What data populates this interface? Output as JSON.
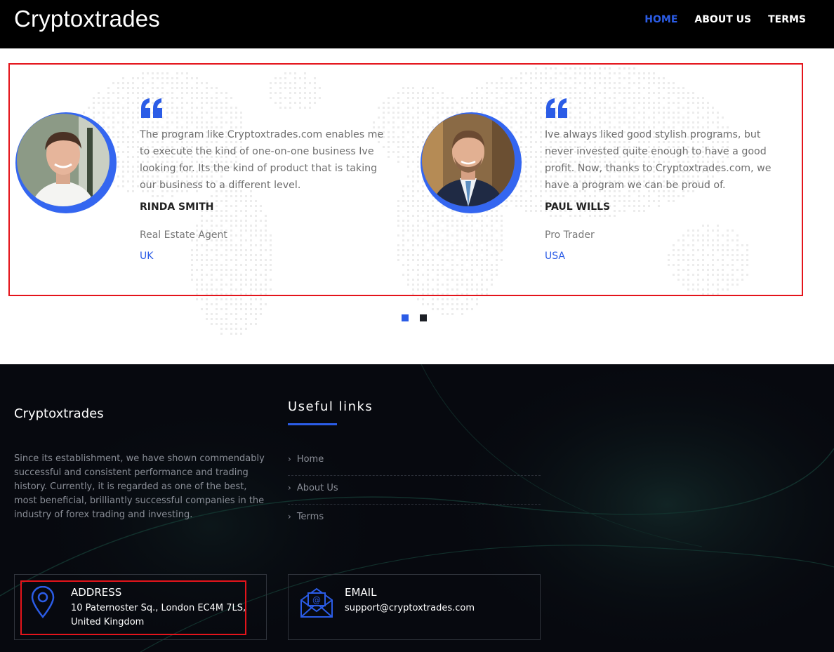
{
  "header": {
    "brand": "Cryptoxtrades",
    "nav": [
      {
        "label": "HOME",
        "active": true
      },
      {
        "label": "ABOUT US",
        "active": false
      },
      {
        "label": "TERMS",
        "active": false
      }
    ]
  },
  "testimonials": [
    {
      "quote": "The program like Cryptoxtrades.com enables me to execute the kind of one-on-one business Ive looking for. Its the kind of product that is taking our business to a different level.",
      "name": "RINDA SMITH",
      "role": "Real Estate Agent",
      "country": "UK"
    },
    {
      "quote": "Ive always liked good stylish programs, but never invested quite enough to have a good profit. Now, thanks to Cryptoxtrades.com, we have a program we can be proud of.",
      "name": "PAUL WILLS",
      "role": "Pro Trader",
      "country": "USA"
    }
  ],
  "carousel": {
    "active_index": 0,
    "count": 2
  },
  "footer": {
    "brand": "Cryptoxtrades",
    "about": "Since its establishment, we have shown commendably successful and consistent performance and trading history. Currently, it is regarded as one of the best, most beneficial, brilliantly successful companies in the industry of forex trading and investing.",
    "links_title": "Useful links",
    "links": [
      "Home",
      "About Us",
      "Terms"
    ],
    "address": {
      "title": "ADDRESS",
      "line1": "10 Paternoster Sq., London EC4M 7LS,",
      "line2": "United Kingdom"
    },
    "email": {
      "title": "EMAIL",
      "value": "support@cryptoxtrades.com"
    }
  },
  "colors": {
    "accent": "#2b5ce6",
    "highlight": "#e4141b",
    "header_bg": "#000000",
    "footer_bg": "#07090f"
  },
  "icons": {
    "quote": "quote-icon",
    "address": "map-pin-icon",
    "email": "envelope-icon",
    "link": "chevron-right-icon"
  }
}
